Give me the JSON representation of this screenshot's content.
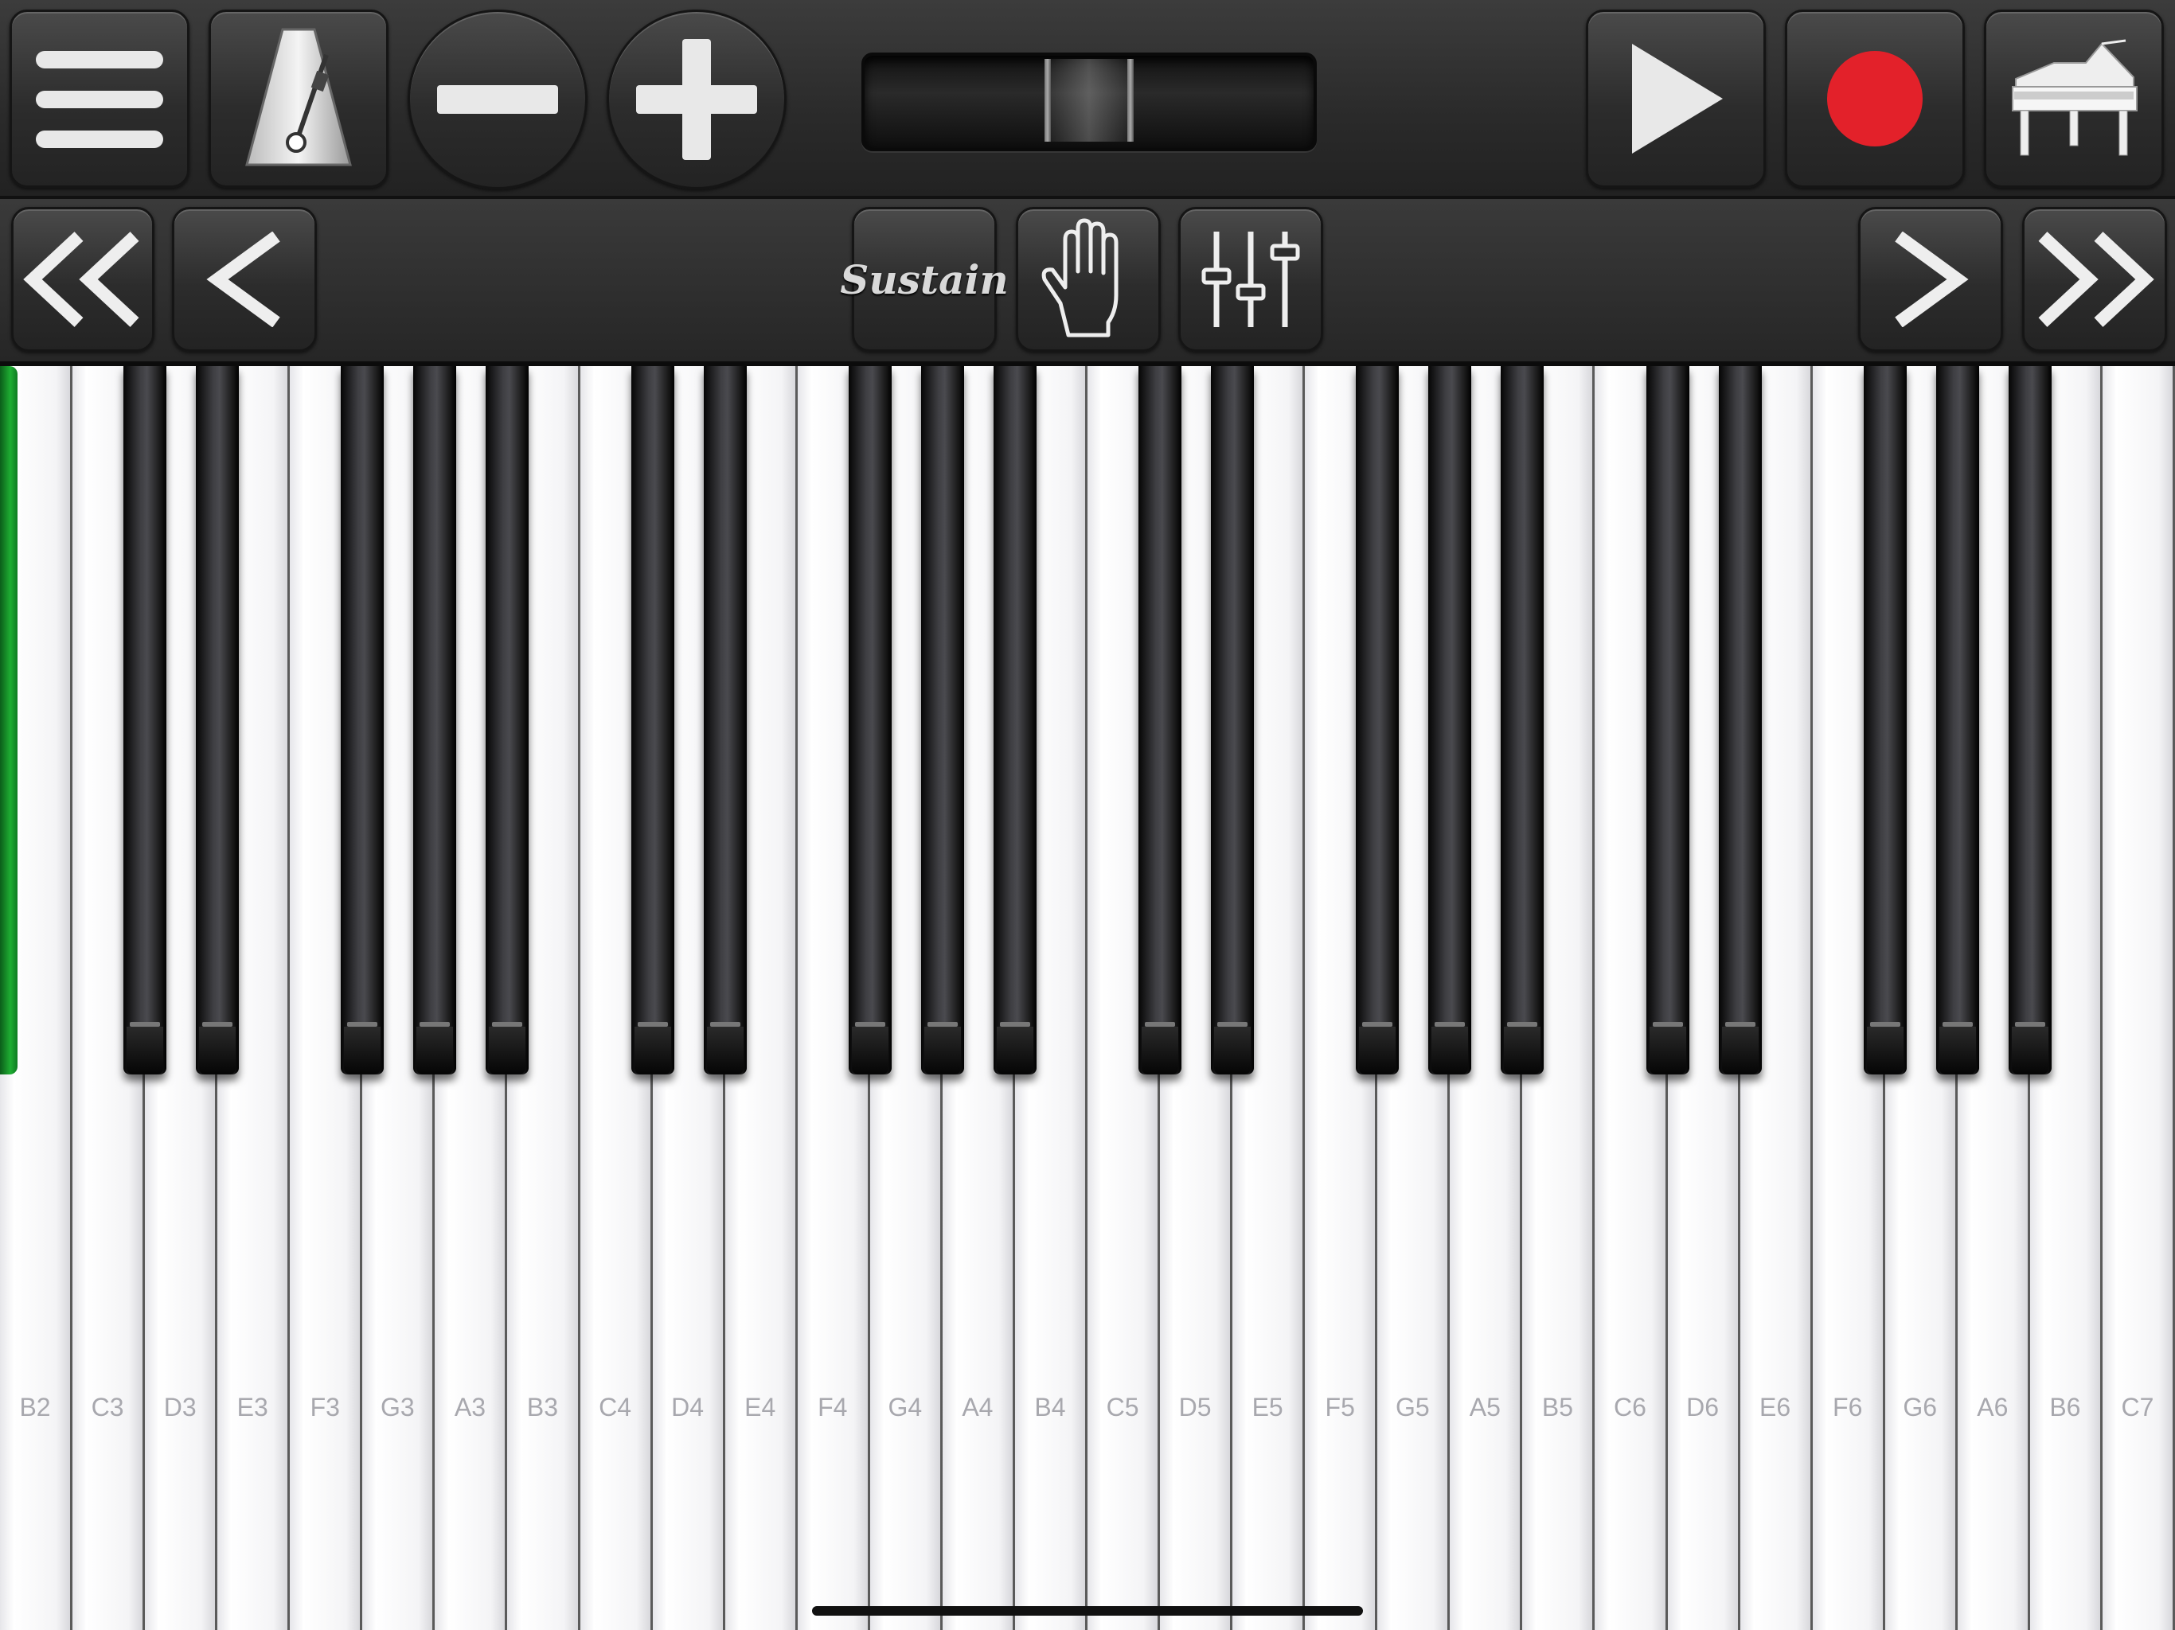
{
  "toolbar": {
    "menu_icon": "hamburger-menu-icon",
    "metronome_icon": "metronome-icon",
    "decrease_icon": "minus-icon",
    "increase_icon": "plus-icon",
    "play_icon": "play-icon",
    "record_icon": "record-icon",
    "instrument_icon": "grand-piano-icon",
    "record_color": "#e3212a"
  },
  "navbar": {
    "jump_back_icon": "double-chevron-left-icon",
    "step_back_icon": "chevron-left-icon",
    "sustain_label": "Sustain",
    "hand_icon": "hand-icon",
    "mixer_icon": "sliders-icon",
    "step_forward_icon": "chevron-right-icon",
    "jump_forward_icon": "double-chevron-right-icon"
  },
  "keyboard": {
    "white_keys": [
      "B2",
      "C3",
      "D3",
      "E3",
      "F3",
      "G3",
      "A3",
      "B3",
      "C4",
      "D4",
      "E4",
      "F4",
      "G4",
      "A4",
      "B4",
      "C5",
      "D5",
      "E5",
      "F5",
      "G5",
      "A5",
      "B5",
      "C6",
      "D6",
      "E6",
      "F6",
      "G6",
      "A6",
      "B6",
      "C7"
    ],
    "highlight_color": "#1fae33"
  }
}
